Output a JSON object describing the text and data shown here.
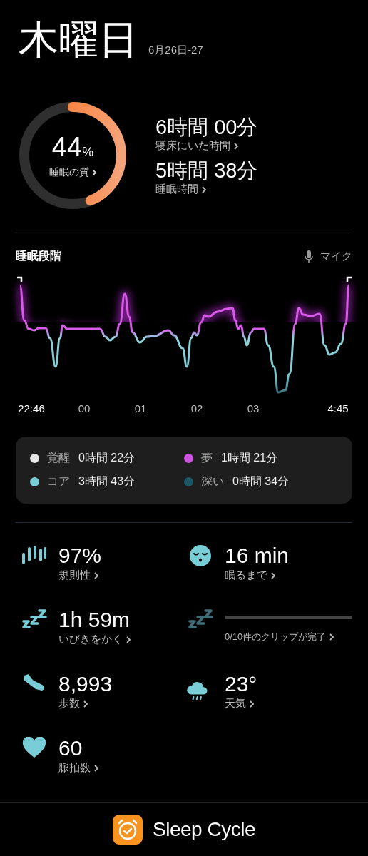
{
  "header": {
    "day": "木曜日",
    "date": "6月26日-27"
  },
  "quality": {
    "value": "44",
    "unit": "%",
    "label": "睡眠の質",
    "level": 0.44
  },
  "durations": [
    {
      "value": "6時間 00分",
      "label": "寝床にいた時間"
    },
    {
      "value": "5時間 38分",
      "label": "睡眠時間"
    }
  ],
  "stages": {
    "title": "睡眠段階",
    "mic_label": "マイク",
    "x_labels": [
      "22:46",
      "00",
      "01",
      "02",
      "03",
      "4:45"
    ],
    "legend": [
      {
        "name": "覚醒",
        "duration": "0時間 22分",
        "color": "#e6e6e6"
      },
      {
        "name": "夢",
        "duration": "1時間 21分",
        "color": "#cf52e3"
      },
      {
        "name": "コア",
        "duration": "3時間 43分",
        "color": "#79cdd6"
      },
      {
        "name": "深い",
        "duration": "0時間 34分",
        "color": "#1d5864"
      }
    ]
  },
  "stats": [
    {
      "kind": "regularity",
      "value": "97%",
      "label": "規則性"
    },
    {
      "kind": "fall_asleep",
      "value": "16 min",
      "label": "眠るまで"
    },
    {
      "kind": "snore",
      "value": "1h 59m",
      "label": "いびきをかく"
    },
    {
      "kind": "clips",
      "label": "0/10件のクリップが完了",
      "level": 0
    },
    {
      "kind": "steps",
      "value": "8,993",
      "label": "歩数"
    },
    {
      "kind": "weather",
      "value": "23°",
      "label": "天気"
    },
    {
      "kind": "heart",
      "value": "60",
      "label": "脈拍数"
    }
  ],
  "footer": {
    "app_name": "Sleep Cycle"
  }
}
